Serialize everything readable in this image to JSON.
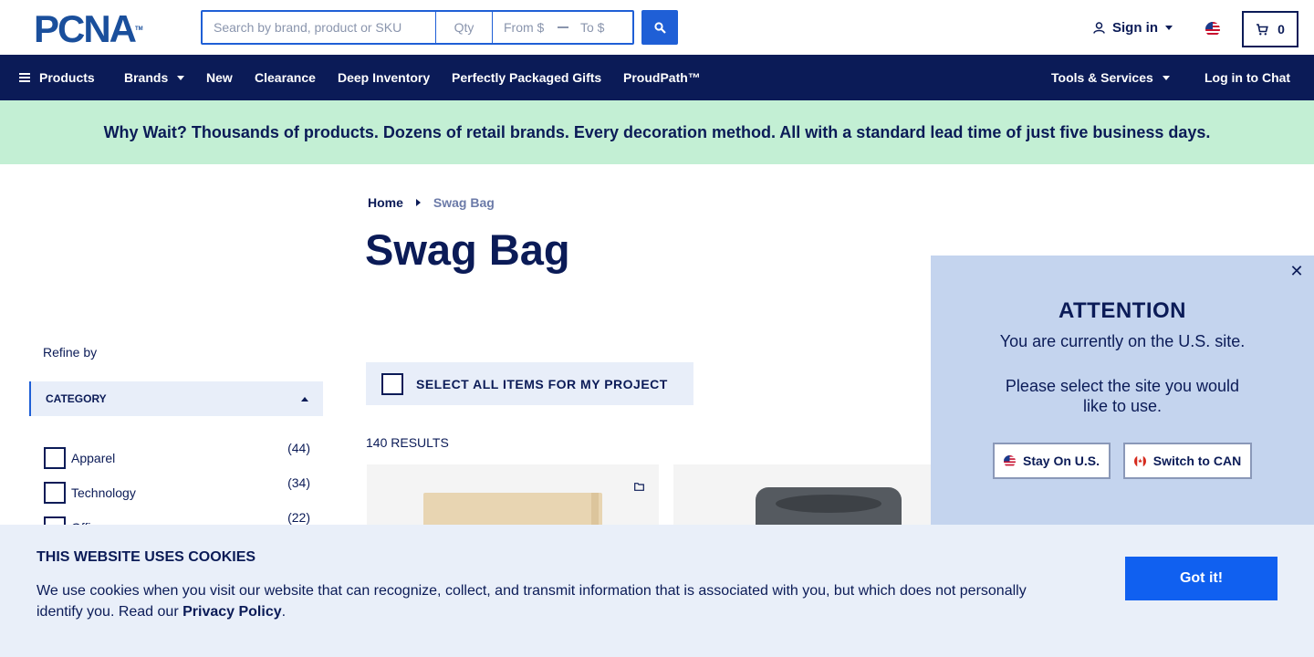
{
  "header": {
    "logo_text": "PCNA",
    "logo_tm": "TM",
    "search_placeholder": "Search by brand, product or SKU",
    "qty_placeholder": "Qty",
    "from_placeholder": "From $",
    "to_placeholder": "To $",
    "signin_label": "Sign in",
    "cart_count": "0"
  },
  "nav": {
    "products": "Products",
    "brands": "Brands",
    "new": "New",
    "clearance": "Clearance",
    "deep_inventory": "Deep Inventory",
    "gifts": "Perfectly Packaged Gifts",
    "proudpath": "ProudPath™",
    "tools": "Tools & Services",
    "chat": "Log in to Chat"
  },
  "promo": {
    "text": "Why Wait? Thousands of products. Dozens of retail brands. Every decoration method. All with a standard lead time of just five business days."
  },
  "breadcrumb": {
    "home": "Home",
    "current": "Swag Bag"
  },
  "page": {
    "title": "Swag Bag",
    "select_all": "SELECT ALL ITEMS FOR MY PROJECT",
    "results": "140 RESULTS"
  },
  "sidebar": {
    "refine": "Refine by",
    "category_heading": "CATEGORY",
    "categories": [
      {
        "label": "Apparel",
        "count": "(44)"
      },
      {
        "label": "Technology",
        "count": "(34)"
      },
      {
        "label": "Office",
        "count": "(22)"
      }
    ]
  },
  "modal": {
    "title": "ATTENTION",
    "line1": "You are currently on the U.S. site.",
    "line2": "Please select the site you would like to use.",
    "stay_label": "Stay On U.S.",
    "switch_label": "Switch to CAN",
    "close_glyph": "✕"
  },
  "cookie": {
    "title": "THIS WEBSITE USES COOKIES",
    "text": "We use cookies when you visit our website that can recognize, collect, and transmit information that is associated with you, but which does not personally identify you. Read our ",
    "link": "Privacy Policy",
    "end": ".",
    "button": "Got it!"
  },
  "colors": {
    "navy": "#0b1b57",
    "accent_blue": "#1f5fd6",
    "promo_green": "#c3efd4",
    "modal_bg": "#c4d4ee",
    "cookie_bg": "#e9eff9"
  }
}
